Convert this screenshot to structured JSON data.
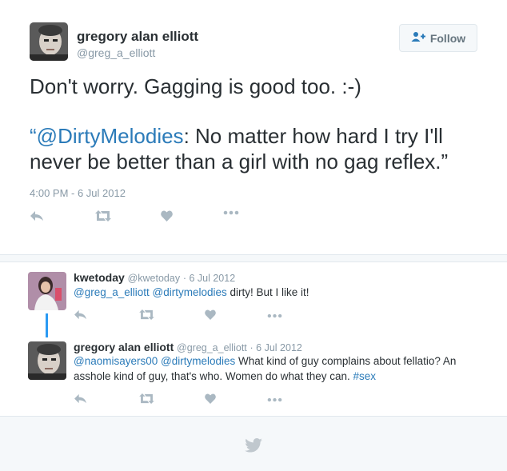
{
  "tweet": {
    "author_name": "gregory alan elliott",
    "author_handle": "@greg_a_elliott",
    "follow_label": "Follow",
    "text_line1": "Don't worry. Gagging is good too. :-)",
    "quote_open": "“",
    "quote_mention": "@DirtyMelodies",
    "quote_rest1": ": No matter how hard I try I'll",
    "quote_line2": "never be better than a girl with no gag reflex.”",
    "timestamp": "4:00 PM - 6 Jul 2012"
  },
  "replies": [
    {
      "author_name": "kwetoday",
      "author_handle": "@kwetoday",
      "date": "· 6 Jul 2012",
      "mention1": "@greg_a_elliott",
      "mention2": "@dirtymelodies",
      "text": " dirty! But I like it!"
    },
    {
      "author_name": "gregory alan elliott",
      "author_handle": "@greg_a_elliott",
      "date": "· 6 Jul 2012",
      "mention1": "@naomisayers00",
      "mention2": "@dirtymelodies",
      "text": " What kind of guy complains about fellatio? An asshole kind of guy, that's who. Women do what they can. ",
      "hashtag": "#sex"
    }
  ],
  "colors": {
    "link": "#2b7bb9",
    "icon": "#aab8c2",
    "thread_line": "#2b9af3",
    "footer_bg": "#f5f8fa"
  },
  "icons": [
    "reply-icon",
    "retweet-icon",
    "like-icon",
    "more-icon",
    "follow-person-icon",
    "twitter-bird-icon"
  ]
}
